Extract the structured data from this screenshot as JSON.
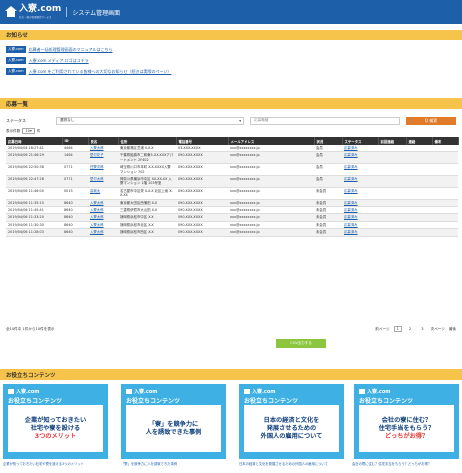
{
  "header": {
    "logo_text": "入寮.com",
    "logo_sub": "社宅・寮の管理運営サービス",
    "title": "システム管理画面"
  },
  "notices": {
    "heading": "お知らせ",
    "items": [
      {
        "badge": "入寮.com",
        "text": "応募者一括処理管理画面のマニュアルはこちら"
      },
      {
        "badge": "入寮.com",
        "text": "入寮.com メディア.ロゴはコチラ"
      },
      {
        "badge": "入寮.com",
        "text": "入寮.com をご利用されている皆様への大切なお知らせ（続きは実際のページ）"
      }
    ]
  },
  "applications": {
    "heading": "応募一覧",
    "filter": {
      "status_label": "ステータス",
      "status_value": "選択なし",
      "keyword_placeholder": "応募職種",
      "search_label": "Q 検索"
    },
    "per_page": {
      "prefix": "表示件数",
      "value": "10",
      "suffix": "件"
    },
    "columns": [
      "応募日時",
      "ID",
      "氏名",
      "住所",
      "電話番号",
      "メールアドレス",
      "状況",
      "ステータス",
      "前回連絡",
      "連絡",
      "備考"
    ],
    "rows": [
      {
        "date": "2019/04/04 18:27:41",
        "id": "4464",
        "name": "入寮太郎",
        "address": "東京都港区芝浦 X-X-X",
        "phone": "03-XXX-XXXX",
        "email": "xxx@xxxxxxxx.jp",
        "state": "会員",
        "status": "応募済み",
        "last": "",
        "contact": "",
        "note": ""
      },
      {
        "date": "2019/04/06 21:46:29",
        "id": "1464",
        "name": "愛付花子",
        "address": "千葉県船橋市二和東5-XX-XXXアパートメント 2F402",
        "phone": "090-XXX-XXXX",
        "email": "xxx@xxxxxxxx.jp",
        "state": "会員",
        "status": "応募済み",
        "last": "",
        "contact": "",
        "note": ""
      },
      {
        "date": "2019/04/06 22:50:38",
        "id": "0771",
        "name": "任寮次郎",
        "address": "埼玉県川口市本町 X-X-XXXX入寮マンション 702",
        "phone": "090-XXX-XXXX",
        "email": "xxx@xxxxxxxx.jp",
        "state": "会員",
        "status": "応募済み",
        "last": "",
        "contact": "",
        "note": ""
      },
      {
        "date": "2019/04/06 22:47:28",
        "id": "0771",
        "name": "愛付太郎",
        "address": "神奈川県横浜市中区 XX-XX-XX 入寮マンション 1階 103号室",
        "phone": "090-XXX-XXXX",
        "email": "xxx@xxxxxxxx.jp",
        "state": "会員",
        "status": "応募済み",
        "last": "",
        "contact": "",
        "note": ""
      },
      {
        "date": "2019/04/06 11:46:00",
        "id": "0015",
        "name": "高城太",
        "address": "名古屋市中区栄 X-X-X 北区上坂 X-X-XX",
        "phone": "090-XXX-XXXX",
        "email": "xxx@xxxxxxxx.jp",
        "state": "未会員",
        "status": "応募済み",
        "last": "",
        "contact": "",
        "note": ""
      },
      {
        "date": "2019/04/06 11:35:15",
        "id": "8640",
        "name": "入寮太郎",
        "address": "東京都大田区西蒲田 X-X",
        "phone": "090-XXX-XXXX",
        "email": "xxx@xxxxxxxx.jp",
        "state": "未会員",
        "status": "応募済み",
        "last": "",
        "contact": "",
        "note": ""
      },
      {
        "date": "2019/04/06 11:45:41",
        "id": "8640",
        "name": "入寮太郎",
        "address": "三重県伊賀市大山田 X-X",
        "phone": "090-XXX-XXXX",
        "email": "xxx@xxxxxxxx.jp",
        "state": "未会員",
        "status": "応募済み",
        "last": "",
        "contact": "",
        "note": ""
      },
      {
        "date": "2019/04/06 11:33:20",
        "id": "8640",
        "name": "入寮太郎",
        "address": "静岡県浜松市中区 X-X",
        "phone": "090-XXX-XXXX",
        "email": "xxx@xxxxxxxx.jp",
        "state": "未会員",
        "status": "応募済み",
        "last": "",
        "contact": "",
        "note": ""
      },
      {
        "date": "2019/04/06 11:30:30",
        "id": "8640",
        "name": "入寮太郎",
        "address": "静岡県浜松市北区 X-X",
        "phone": "090-XXX-XXXX",
        "email": "xxx@xxxxxxxx.jp",
        "state": "未会員",
        "status": "応募済み",
        "last": "",
        "contact": "",
        "note": ""
      },
      {
        "date": "2019/04/06 11:28:03",
        "id": "8640",
        "name": "入寮太郎",
        "address": "静岡県浜松市西区 X-X",
        "phone": "090-XXX-XXXX",
        "email": "xxx@xxxxxxxx.jp",
        "state": "未会員",
        "status": "応募済み",
        "last": "",
        "contact": "",
        "note": ""
      }
    ],
    "summary": "全10件中 1件から10件を表示",
    "pager": {
      "prev": "前ページ",
      "pages": [
        "1",
        "2",
        "3"
      ],
      "active": "1",
      "next": "次ページ",
      "last": "最後"
    },
    "csv_label": "CSV出力する"
  },
  "useful": {
    "heading": "お役立ちコンテンツ",
    "cards": [
      {
        "logo": "入寮.com",
        "sub": "お役立ちコンテンツ",
        "line1": "企業が知っておきたい",
        "line2": "社宅や寮を設ける",
        "line3": "3つのメリット",
        "caption": "企業が知っておきたい社宅や寮を設ける3つのメリット"
      },
      {
        "logo": "入寮.com",
        "sub": "お役立ちコンテンツ",
        "line1": "「寮」を競争力に",
        "line2": "人を誘致できた事例",
        "line3": "",
        "caption": "「寮」を競争力に人を誘致できた事例"
      },
      {
        "logo": "入寮.com",
        "sub": "お役立ちコンテンツ",
        "line1": "日本の経済と文化を",
        "line2": "発展させるための",
        "line3": "外国人の雇用について",
        "caption": "日本の経済と文化を発展させるための外国人の雇用について"
      },
      {
        "logo": "入寮.com",
        "sub": "お役立ちコンテンツ",
        "line1": "会社の寮に住む？",
        "line2": "住宅手当をもらう？",
        "line3": "どっちがお得？",
        "caption": "会社の寮に住む？住宅手当をもらう？どっちがお得？"
      }
    ]
  }
}
